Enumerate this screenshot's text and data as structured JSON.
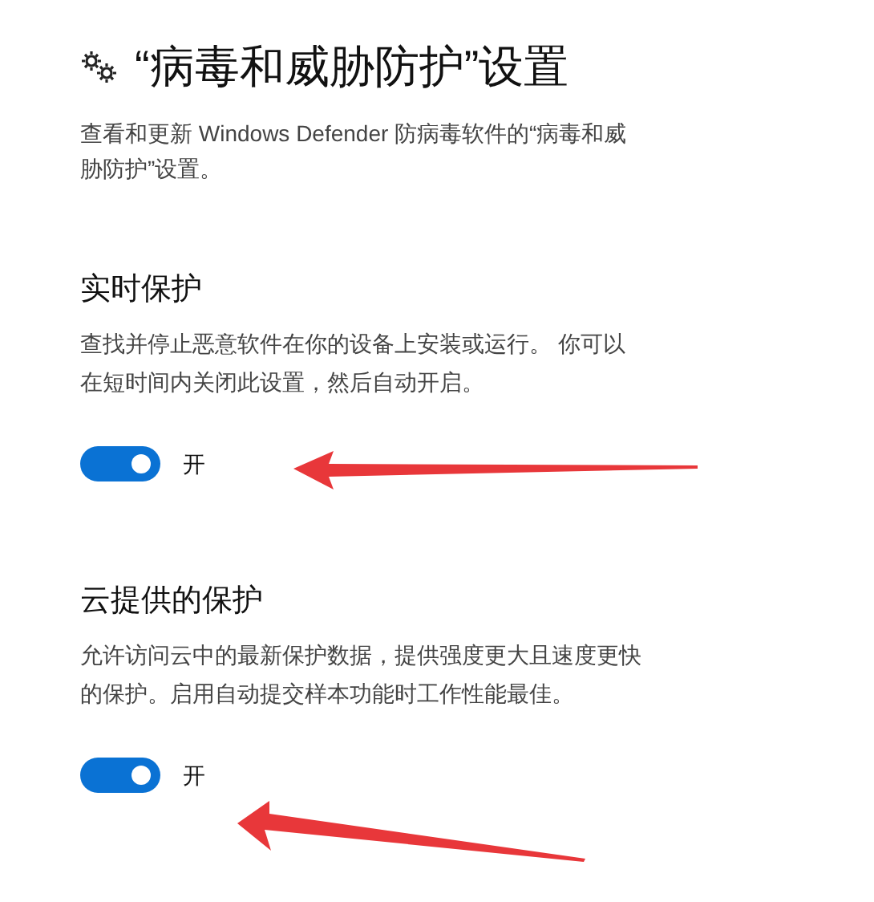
{
  "page": {
    "title": "“病毒和威胁防护”设置",
    "description": "查看和更新 Windows Defender 防病毒软件的“病毒和威胁防护”设置。"
  },
  "sections": [
    {
      "heading": "实时保护",
      "description": "查找并停止恶意软件在你的设备上安装或运行。 你可以在短时间内关闭此设置，然后自动开启。",
      "toggle": {
        "on": true,
        "label": "开"
      }
    },
    {
      "heading": "云提供的保护",
      "description": "允许访问云中的最新保护数据，提供强度更大且速度更快的保护。启用自动提交样本功能时工作性能最佳。",
      "toggle": {
        "on": true,
        "label": "开"
      }
    }
  ]
}
